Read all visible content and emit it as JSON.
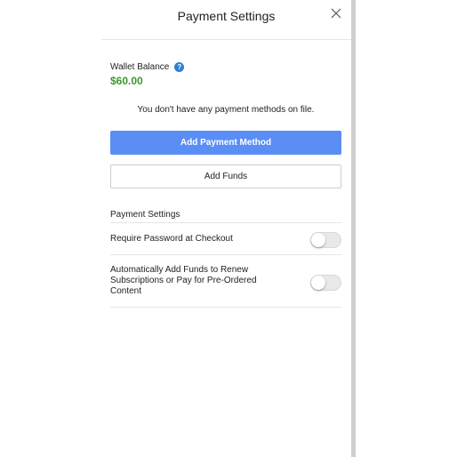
{
  "header": {
    "title": "Payment Settings"
  },
  "wallet": {
    "label": "Wallet Balance",
    "help_glyph": "?",
    "amount": "$60.00",
    "amount_color": "#3a9a2c"
  },
  "payment_methods": {
    "empty_message": "You don't have any payment methods on file.",
    "add_method_label": "Add Payment Method",
    "add_funds_label": "Add Funds",
    "accent_color": "#5b8ef5"
  },
  "settings": {
    "heading": "Payment Settings",
    "items": [
      {
        "label": "Require Password at Checkout",
        "enabled": false
      },
      {
        "label_lines": [
          "Automatically Add Funds to Renew",
          "Subscriptions or Pay for Pre-Ordered",
          "Content"
        ],
        "enabled": false
      }
    ]
  }
}
